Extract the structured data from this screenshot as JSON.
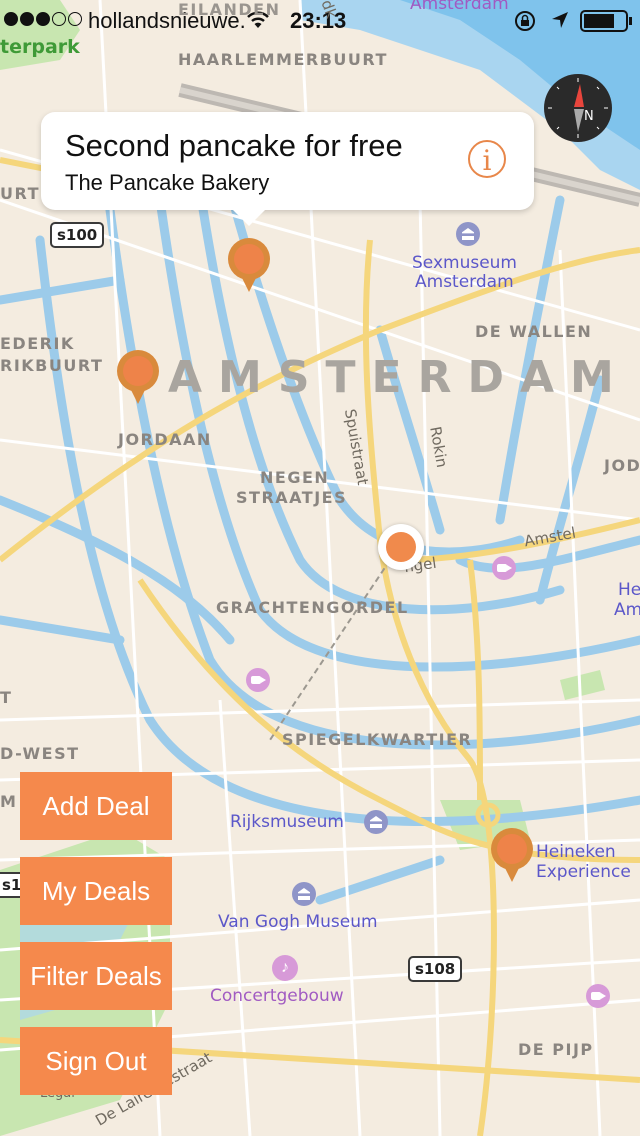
{
  "status_bar": {
    "carrier": "hollandsnieuwe.",
    "time": "23:13",
    "signal_bars": 3,
    "signal_max": 5
  },
  "callout": {
    "title": "Second pancake for free",
    "subtitle": "The Pancake Bakery",
    "info_icon": "i"
  },
  "map_labels": {
    "city": "AMSTERDAM",
    "haarlemmerbuurt": "HAARLEMMERBUURT",
    "eilanden": "EILANDEN",
    "amsterdam_top": "Amsterdam",
    "park_top": "terpark",
    "frederik": "EDERIK",
    "frederik2": "RIKBUURT",
    "jordaan": "JORDAAN",
    "negen1": "NEGEN",
    "negen2": "STRAATJES",
    "de_wallen": "DE WALLEN",
    "joden": "JODEN",
    "spuistraat": "Spuistraat",
    "rokin": "Rokin",
    "amstel": "Amstel",
    "singel": "ngel",
    "grachtengordel": "GRACHTENGORDEL",
    "spiegelkwartier": "SPIEGELKWARTIER",
    "west": "D-WEST",
    "m_left": "M",
    "t_left": "T",
    "urt": "URT",
    "he": "He",
    "am": "Am",
    "de_pijp": "DE PIJP",
    "delaire": "De Lairessestraat",
    "pd": "dk",
    "legal": "Legal",
    "sexmuseum1": "Sexmuseum",
    "sexmuseum2": "Amsterdam",
    "rijksmuseum": "Rijksmuseum",
    "heineken1": "Heineken",
    "heineken2": "Experience",
    "vangogh": "Van Gogh Museum",
    "concertgebouw": "Concertgebouw",
    "s100": "s100",
    "s108": "s108",
    "s1": "s1"
  },
  "buttons": {
    "add_deal": "Add Deal",
    "my_deals": "My Deals",
    "filter_deals": "Filter Deals",
    "sign_out": "Sign Out"
  },
  "compass_letter": "N"
}
